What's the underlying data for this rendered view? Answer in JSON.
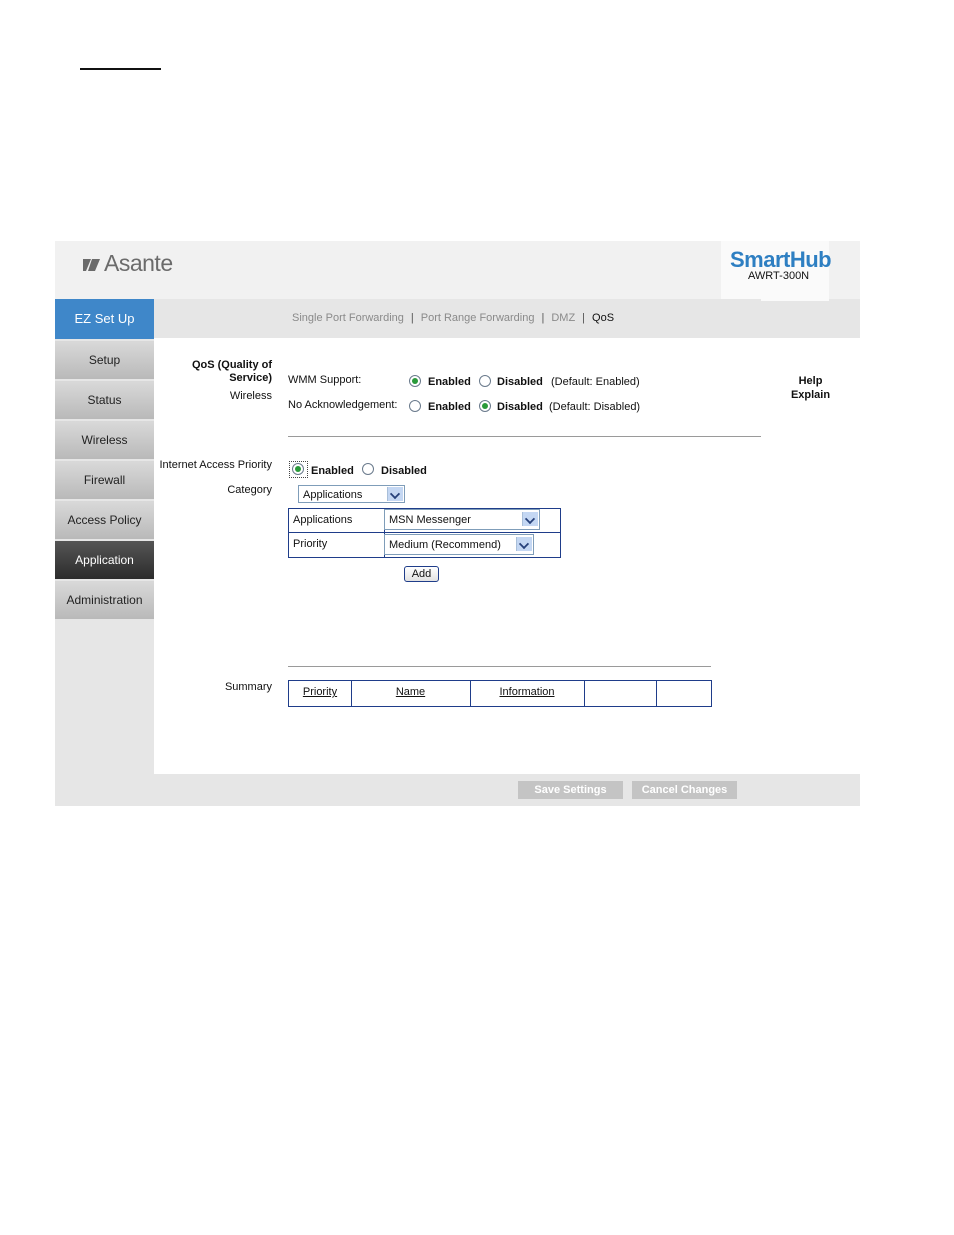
{
  "header": {
    "brand_left": "Asante",
    "brand_right": "SmartHub",
    "model": "AWRT-300N"
  },
  "top_nav": {
    "links": [
      "Single Port Forwarding",
      "Port Range Forwarding",
      "DMZ",
      "QoS"
    ],
    "separator": "|",
    "active": "QoS"
  },
  "sidebar": {
    "items": [
      "EZ Set Up",
      "Setup",
      "Status",
      "Wireless",
      "Firewall",
      "Access Policy",
      "Application",
      "Administration"
    ]
  },
  "qos": {
    "section_title_line1": "QoS (Quality of",
    "section_title_line2": "Service)",
    "wireless_label": "Wireless",
    "wmm_label": "WMM Support:",
    "wmm_enabled": "Enabled",
    "wmm_disabled": "Disabled",
    "wmm_default": "(Default: Enabled)",
    "noack_label": "No Acknowledgement:",
    "noack_enabled": "Enabled",
    "noack_disabled": "Disabled",
    "noack_default": "(Default: Disabled)",
    "iap_label": "Internet Access Priority",
    "iap_enabled": "Enabled",
    "iap_disabled": "Disabled",
    "category_label": "Category",
    "category_value": "Applications",
    "applications_label": "Applications",
    "applications_value": "MSN Messenger",
    "priority_label": "Priority",
    "priority_value": "Medium (Recommend)",
    "add_label": "Add",
    "summary_label": "Summary",
    "summary_columns": [
      "Priority",
      "Name",
      "Information",
      "",
      ""
    ]
  },
  "help": {
    "line1": "Help",
    "line2": "Explain"
  },
  "footer": {
    "save": "Save Settings",
    "cancel": "Cancel Changes"
  }
}
